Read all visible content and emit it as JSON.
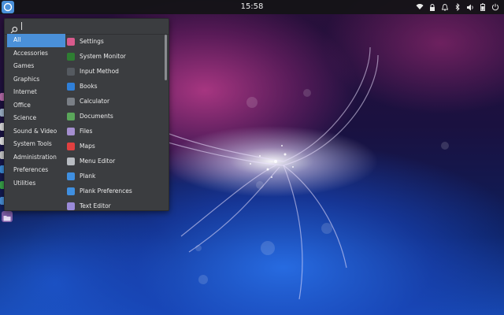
{
  "topbar": {
    "clock": "15:58",
    "tray_icons": [
      "wifi-icon",
      "lock-icon",
      "bell-icon",
      "bluetooth-icon",
      "volume-icon",
      "battery-icon",
      "power-icon"
    ]
  },
  "search": {
    "value": "",
    "placeholder": ""
  },
  "categories": [
    {
      "label": "All",
      "active": true
    },
    {
      "label": "Accessories"
    },
    {
      "label": "Games"
    },
    {
      "label": "Graphics"
    },
    {
      "label": "Internet"
    },
    {
      "label": "Office"
    },
    {
      "label": "Science"
    },
    {
      "label": "Sound & Video"
    },
    {
      "label": "System Tools"
    },
    {
      "label": "Administration"
    },
    {
      "label": "Preferences"
    },
    {
      "label": "Utilities"
    }
  ],
  "apps": [
    {
      "label": "Settings",
      "icon": "settings-icon",
      "color": "#d85a8c"
    },
    {
      "label": "System Monitor",
      "icon": "system-monitor-icon",
      "color": "#2e7d32"
    },
    {
      "label": "Input Method",
      "icon": "input-method-icon",
      "color": "#555a60"
    },
    {
      "label": "Books",
      "icon": "books-icon",
      "color": "#2f7fd8"
    },
    {
      "label": "Calculator",
      "icon": "calculator-icon",
      "color": "#7a7f86"
    },
    {
      "label": "Documents",
      "icon": "documents-icon",
      "color": "#5aa65a"
    },
    {
      "label": "Files",
      "icon": "files-icon",
      "color": "#a58fd0"
    },
    {
      "label": "Maps",
      "icon": "maps-icon",
      "color": "#e04040"
    },
    {
      "label": "Menu Editor",
      "icon": "menu-editor-icon",
      "color": "#b8bcc2"
    },
    {
      "label": "Plank",
      "icon": "plank-icon",
      "color": "#3f8fe0"
    },
    {
      "label": "Plank Preferences",
      "icon": "plank-preferences-icon",
      "color": "#3f8fe0"
    },
    {
      "label": "Text Editor",
      "icon": "text-editor-icon",
      "color": "#9a8ad8"
    }
  ],
  "colors": {
    "accent": "#4a90d9",
    "menu_bg": "#3b3d40",
    "topbar_bg": "#141416"
  }
}
